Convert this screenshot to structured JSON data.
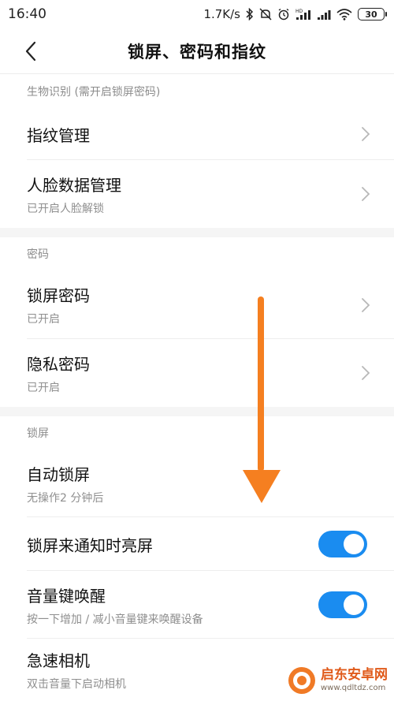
{
  "status_bar": {
    "time": "16:40",
    "network_speed": "1.7K/s",
    "icons": [
      "bluetooth-icon",
      "mute-icon",
      "alarm-icon",
      "hd-signal-icon",
      "signal-icon",
      "wifi-icon"
    ],
    "battery": "30"
  },
  "header": {
    "title": "锁屏、密码和指纹",
    "back_icon": "chevron-left-icon"
  },
  "sections": {
    "biometrics": {
      "label": "生物识别 (需开启锁屏密码)",
      "items": [
        {
          "title": "指纹管理",
          "subtitle": ""
        },
        {
          "title": "人脸数据管理",
          "subtitle": "已开启人脸解锁"
        }
      ]
    },
    "password": {
      "label": "密码",
      "items": [
        {
          "title": "锁屏密码",
          "subtitle": "已开启"
        },
        {
          "title": "隐私密码",
          "subtitle": "已开启"
        }
      ]
    },
    "lockscreen": {
      "label": "锁屏",
      "items": [
        {
          "title": "自动锁屏",
          "subtitle": "无操作2 分钟后"
        },
        {
          "title": "锁屏来通知时亮屏",
          "subtitle": "",
          "toggle": true
        },
        {
          "title": "音量键唤醒",
          "subtitle": "按一下增加 / 减小音量键来唤醒设备",
          "toggle": true
        },
        {
          "title": "急速相机",
          "subtitle": "双击音量下启动相机"
        }
      ]
    }
  },
  "colors": {
    "toggle_on": "#1a8cf0",
    "annotation_arrow": "#f57f20",
    "section_label": "#8c8c8c"
  },
  "watermark": {
    "title": "启东安卓网",
    "url": "www.qdltdz.com"
  }
}
